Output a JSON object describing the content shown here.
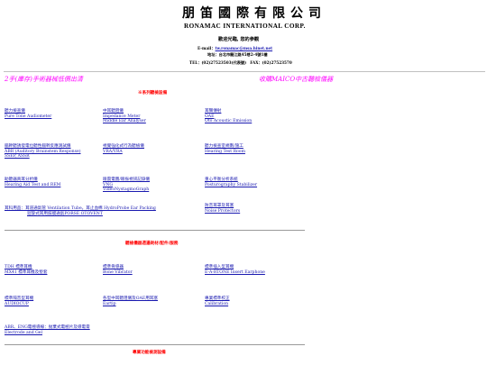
{
  "header": {
    "title_cn": "朋笛國際有限公司",
    "title_en": "RONAMAC INTERNATIONAL CORP.",
    "welcome": "歡迎光臨, 您的參觀",
    "email_label": "E-mail：",
    "email_value": "tw.ronamac@msa.hinet.net",
    "address": "地址：台北市龍江路45巷2-4號1樓",
    "tel": "TEL：(02)27523503(代表號)　FAX：(02)27523570"
  },
  "banners": {
    "left": "2手(庫存)手術器械低價出清",
    "right": "收購MAICO中古聽檢儀器"
  },
  "sections": {
    "series_title": "※系列聽檢設備",
    "accessories_title": "聽檢儀器週邊耗材/配件/服務",
    "bottom_title": "專業功能檢測設備"
  },
  "links": {
    "pure_tone": [
      "聽力檢查儀",
      "Pure Tone Audiometer"
    ],
    "impedance": [
      "中耳聽阻儀",
      "Impedance Meter",
      "Middle Ear Analyser"
    ],
    "oae": [
      "耳聲傳射",
      "OAE",
      "Oto Acoustic Emission"
    ],
    "abr": [
      "腦幹聽誘發電位聽性腦幹反應測試儀",
      "ABR (Auditory Brainstem Response)",
      "SSEP, ASSR"
    ],
    "vra": [
      "視覺強化式行為聽檢儀",
      "VRA/VRA"
    ],
    "test_room": [
      "聽力檢查室規劃/施工",
      "Hearing Test Room"
    ],
    "hearing_aid": [
      "助聽器真耳分析儀",
      "Hearing Aid Test and REM"
    ],
    "vng": [
      "眼震電圖/眼振視訊記錄儀",
      "VNG",
      "VideoNystagmoGraph"
    ],
    "posturography": [
      "重心平衡分析系統",
      "Posturography Stabilizer"
    ],
    "ear_supplies": [
      "耳科用品：耳道通氣管 Ventilation Tube，耳止血棉 HydroProbe Ear Packing",
      "迴旋式耳用鼓膜通氣PORSE OTOVENT"
    ],
    "noise_protector": [
      "防音耳罩及耳塞",
      "Noise Protectors"
    ],
    "tdh": [
      "TDH 標準耳機",
      "MX41 標準耳機及墊套"
    ],
    "bone_vibrator": [
      "標準骨導器",
      "Bone Vibrator"
    ],
    "eartone": [
      "標準插入型耳機",
      "E-A-RTONE Insert Earphone"
    ],
    "audiocup": [
      "標準隔音型耳機",
      "AUDIOCUP"
    ],
    "eartip": [
      "各型中耳聽阻儀及OAE用耳塞",
      "Eartip"
    ],
    "calibration": [
      "專業標準校正",
      "Calibration"
    ],
    "electrode": [
      "ABR、ENG電極導線：拋棄式電極片及導電膏",
      "Electrode and Gel"
    ]
  }
}
